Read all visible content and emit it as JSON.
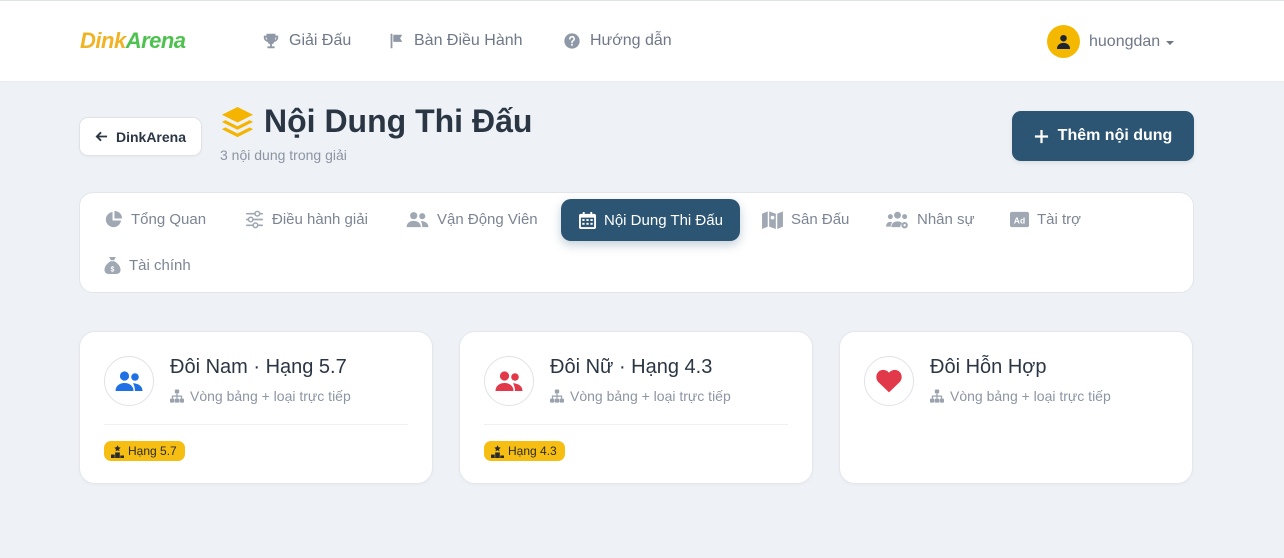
{
  "navbar": {
    "logo_part1": "Dink",
    "logo_part2": "Arena",
    "links": [
      {
        "label": "Giải Đấu",
        "icon": "trophy-icon"
      },
      {
        "label": "Bàn Điều Hành",
        "icon": "flag-icon"
      },
      {
        "label": "Hướng dẫn",
        "icon": "question-circle-icon"
      }
    ],
    "user": {
      "name": "huongdan",
      "icon": "user-icon"
    }
  },
  "header": {
    "back_label": "DinkArena",
    "title": "Nội Dung Thi Đấu",
    "subtitle": "3 nội dung trong giải",
    "add_label": "Thêm nội dung"
  },
  "tabs": [
    {
      "label": "Tổng Quan",
      "icon": "chart-pie-icon",
      "active": false
    },
    {
      "label": "Điều hành giải",
      "icon": "sliders-icon",
      "active": false
    },
    {
      "label": "Vận Động Viên",
      "icon": "user-group-icon",
      "active": false
    },
    {
      "label": "Nội Dung Thi Đấu",
      "icon": "calendar-icon",
      "active": true
    },
    {
      "label": "Sân Đấu",
      "icon": "map-icon",
      "active": false
    },
    {
      "label": "Nhân sự",
      "icon": "users-gear-icon",
      "active": false
    },
    {
      "label": "Tài trợ",
      "icon": "ad-icon",
      "active": false
    },
    {
      "label": "Tài chính",
      "icon": "money-bag-icon",
      "active": false
    }
  ],
  "events": [
    {
      "name": "Đôi Nam · Hạng 5.7",
      "format": "Vòng bảng + loại trực tiếp",
      "badge": "Hạng 5.7",
      "icon": "user-group-icon",
      "icon_color": "#1f6fe5"
    },
    {
      "name": "Đôi Nữ · Hạng 4.3",
      "format": "Vòng bảng + loại trực tiếp",
      "badge": "Hạng 4.3",
      "icon": "user-group-icon",
      "icon_color": "#e2394a"
    },
    {
      "name": "Đôi Hỗn Hợp",
      "format": "Vòng bảng + loại trực tiếp",
      "badge": null,
      "icon": "heart-icon",
      "icon_color": "#e2394a"
    }
  ],
  "colors": {
    "primary": "#2b5572",
    "badge": "#f6be13",
    "logo_yellow": "#f0b323",
    "logo_green": "#4ec24e"
  }
}
